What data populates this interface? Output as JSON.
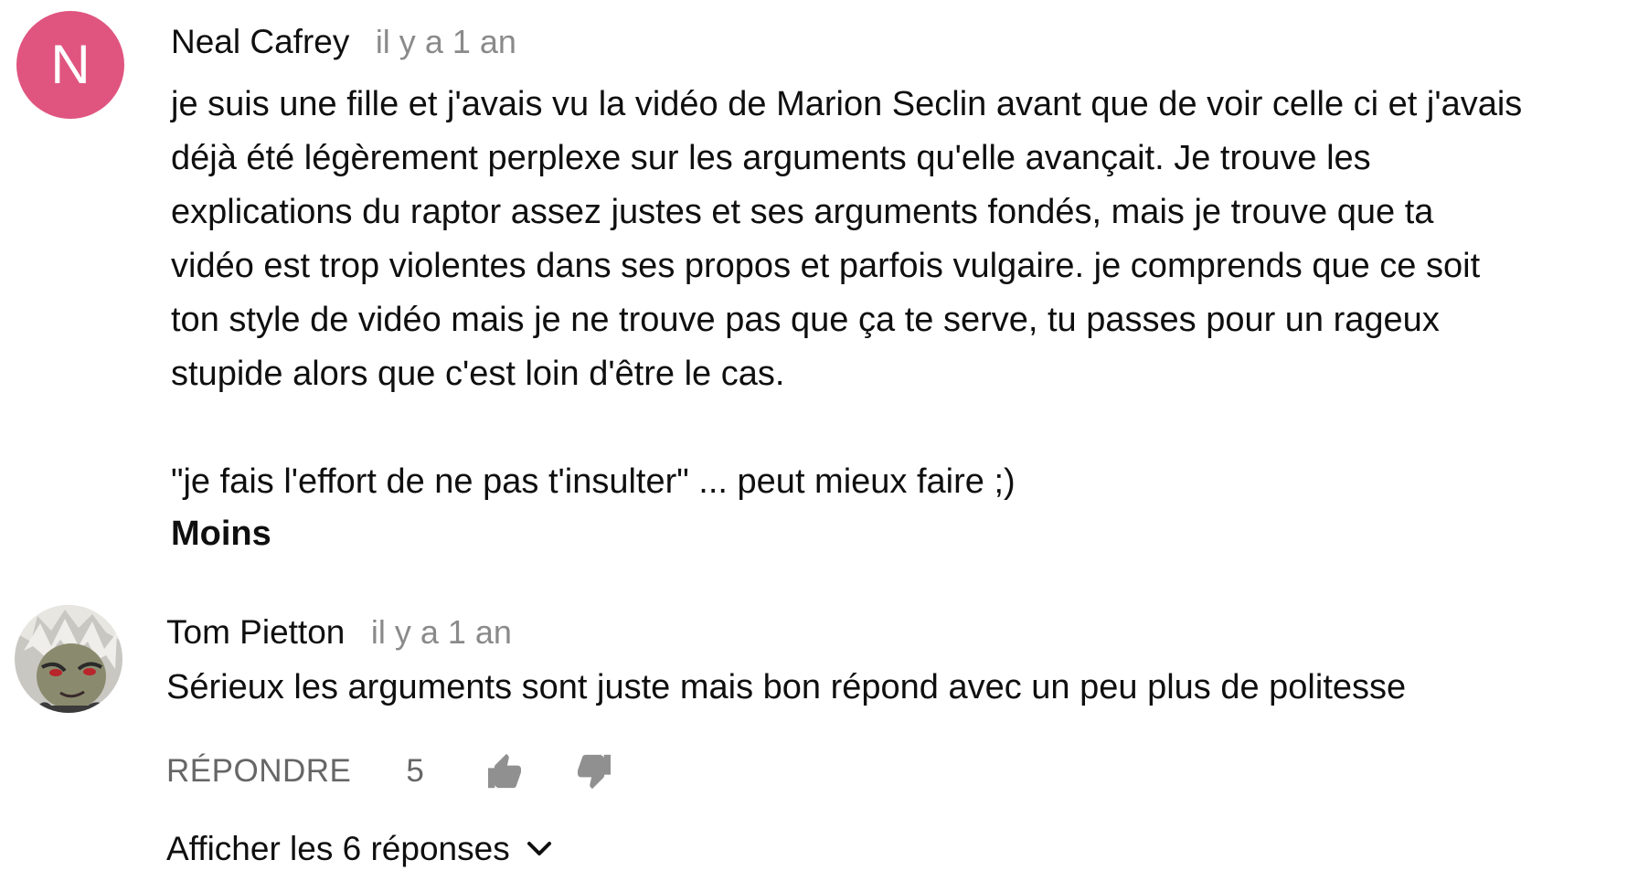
{
  "comments": [
    {
      "avatar_letter": "N",
      "avatar_color": "#e0557f",
      "author": "Neal Cafrey",
      "time": "il y a 1 an",
      "body_lines": [
        "je suis une fille et j'avais vu la vidéo de Marion Seclin avant que de voir celle ci et j'avais",
        "déjà été légèrement perplexe sur les arguments qu'elle avançait. Je trouve les",
        "explications du raptor assez justes et ses arguments fondés, mais je trouve que ta",
        "vidéo est trop violentes dans ses propos et parfois vulgaire. je comprends que ce soit",
        "ton style de vidéo mais je ne trouve pas que ça te serve, tu passes pour un rageux",
        "stupide alors que c'est loin d'être le cas."
      ],
      "quote_line": "\"je fais l'effort de ne pas t'insulter\" ... peut mieux faire ;)",
      "less_label": "Moins"
    },
    {
      "avatar_icon": "anime-character-avatar",
      "author": "Tom Pietton",
      "time": "il y a 1 an",
      "body": "Sérieux les arguments sont juste mais bon répond avec un peu plus de politesse",
      "reply_label": "RÉPONDRE",
      "like_count": "5",
      "like_icon": "thumbs-up-icon",
      "dislike_icon": "thumbs-down-icon",
      "show_replies_label": "Afficher les 6 réponses",
      "show_replies_icon": "chevron-down-icon"
    }
  ],
  "colors": {
    "text_primary": "#0f0f0f",
    "text_secondary": "#8a8a8a",
    "action_gray": "#666666"
  }
}
